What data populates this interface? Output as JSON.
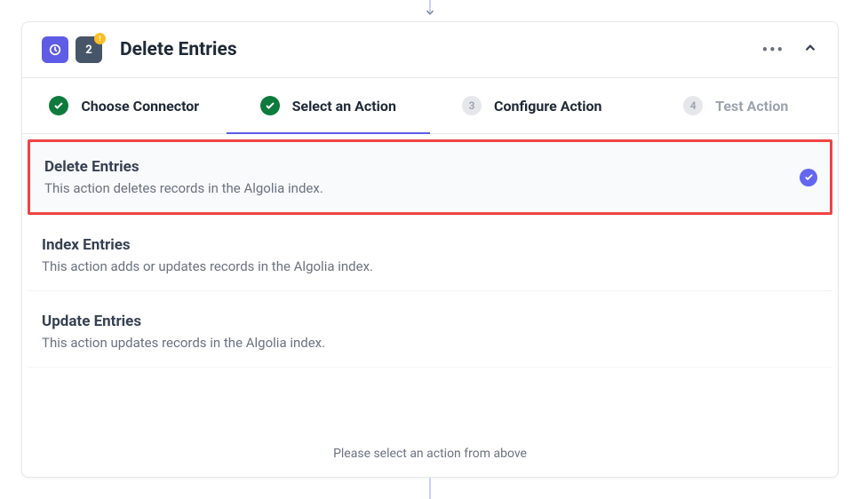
{
  "header": {
    "step_number": "2",
    "title": "Delete Entries"
  },
  "tabs": [
    {
      "label": "Choose Connector",
      "status": "done"
    },
    {
      "label": "Select an Action",
      "status": "done",
      "active": true
    },
    {
      "label": "Configure Action",
      "status": "pending",
      "number": "3"
    },
    {
      "label": "Test Action",
      "status": "pending",
      "number": "4",
      "muted": true
    }
  ],
  "actions": [
    {
      "title": "Delete Entries",
      "desc": "This action deletes records in the Algolia index.",
      "selected": true
    },
    {
      "title": "Index Entries",
      "desc": "This action adds or updates records in the Algolia index.",
      "selected": false
    },
    {
      "title": "Update Entries",
      "desc": "This action updates records in the Algolia index.",
      "selected": false
    }
  ],
  "footer": "Please select an action from above"
}
